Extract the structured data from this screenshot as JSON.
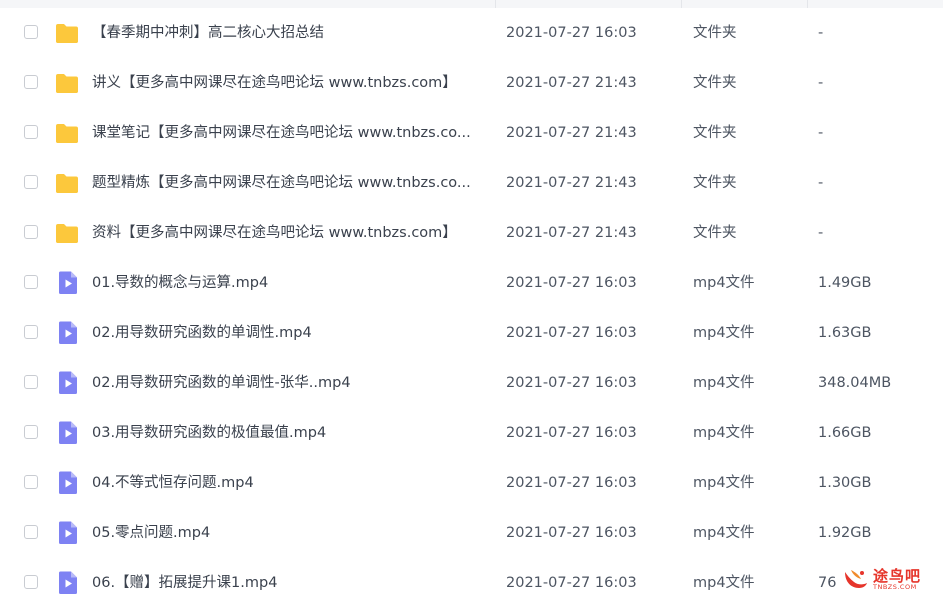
{
  "file_list": {
    "rows": [
      {
        "icon": "folder-icon",
        "name": "【春季期中冲刺】高二核心大招总结",
        "date": "2021-07-27 16:03",
        "type": "文件夹",
        "size": "-"
      },
      {
        "icon": "folder-icon",
        "name": "讲义【更多高中网课尽在途鸟吧论坛 www.tnbzs.com】",
        "date": "2021-07-27 21:43",
        "type": "文件夹",
        "size": "-"
      },
      {
        "icon": "folder-icon",
        "name": "课堂笔记【更多高中网课尽在途鸟吧论坛 www.tnbzs.co...",
        "date": "2021-07-27 21:43",
        "type": "文件夹",
        "size": "-"
      },
      {
        "icon": "folder-icon",
        "name": "题型精炼【更多高中网课尽在途鸟吧论坛 www.tnbzs.co...",
        "date": "2021-07-27 21:43",
        "type": "文件夹",
        "size": "-"
      },
      {
        "icon": "folder-icon",
        "name": "资料【更多高中网课尽在途鸟吧论坛 www.tnbzs.com】",
        "date": "2021-07-27 21:43",
        "type": "文件夹",
        "size": "-"
      },
      {
        "icon": "video-file-icon",
        "name": "01.导数的概念与运算.mp4",
        "date": "2021-07-27 16:03",
        "type": "mp4文件",
        "size": "1.49GB"
      },
      {
        "icon": "video-file-icon",
        "name": "02.用导数研究函数的单调性.mp4",
        "date": "2021-07-27 16:03",
        "type": "mp4文件",
        "size": "1.63GB"
      },
      {
        "icon": "video-file-icon",
        "name": "02.用导数研究函数的单调性-张华..mp4",
        "date": "2021-07-27 16:03",
        "type": "mp4文件",
        "size": "348.04MB"
      },
      {
        "icon": "video-file-icon",
        "name": "03.用导数研究函数的极值最值.mp4",
        "date": "2021-07-27 16:03",
        "type": "mp4文件",
        "size": "1.66GB"
      },
      {
        "icon": "video-file-icon",
        "name": "04.不等式恒存问题.mp4",
        "date": "2021-07-27 16:03",
        "type": "mp4文件",
        "size": "1.30GB"
      },
      {
        "icon": "video-file-icon",
        "name": "05.零点问题.mp4",
        "date": "2021-07-27 16:03",
        "type": "mp4文件",
        "size": "1.92GB"
      },
      {
        "icon": "video-file-icon",
        "name": "06.【赠】拓展提升课1.mp4",
        "date": "2021-07-27 16:03",
        "type": "mp4文件",
        "size": "76"
      }
    ]
  },
  "watermark": {
    "name": "途鸟吧",
    "domain": "TNBZS.COM"
  },
  "colors": {
    "folder": "#fcc83c",
    "video": "#7e82f3",
    "text": "#3a414d",
    "watermark": "#e6352b"
  }
}
